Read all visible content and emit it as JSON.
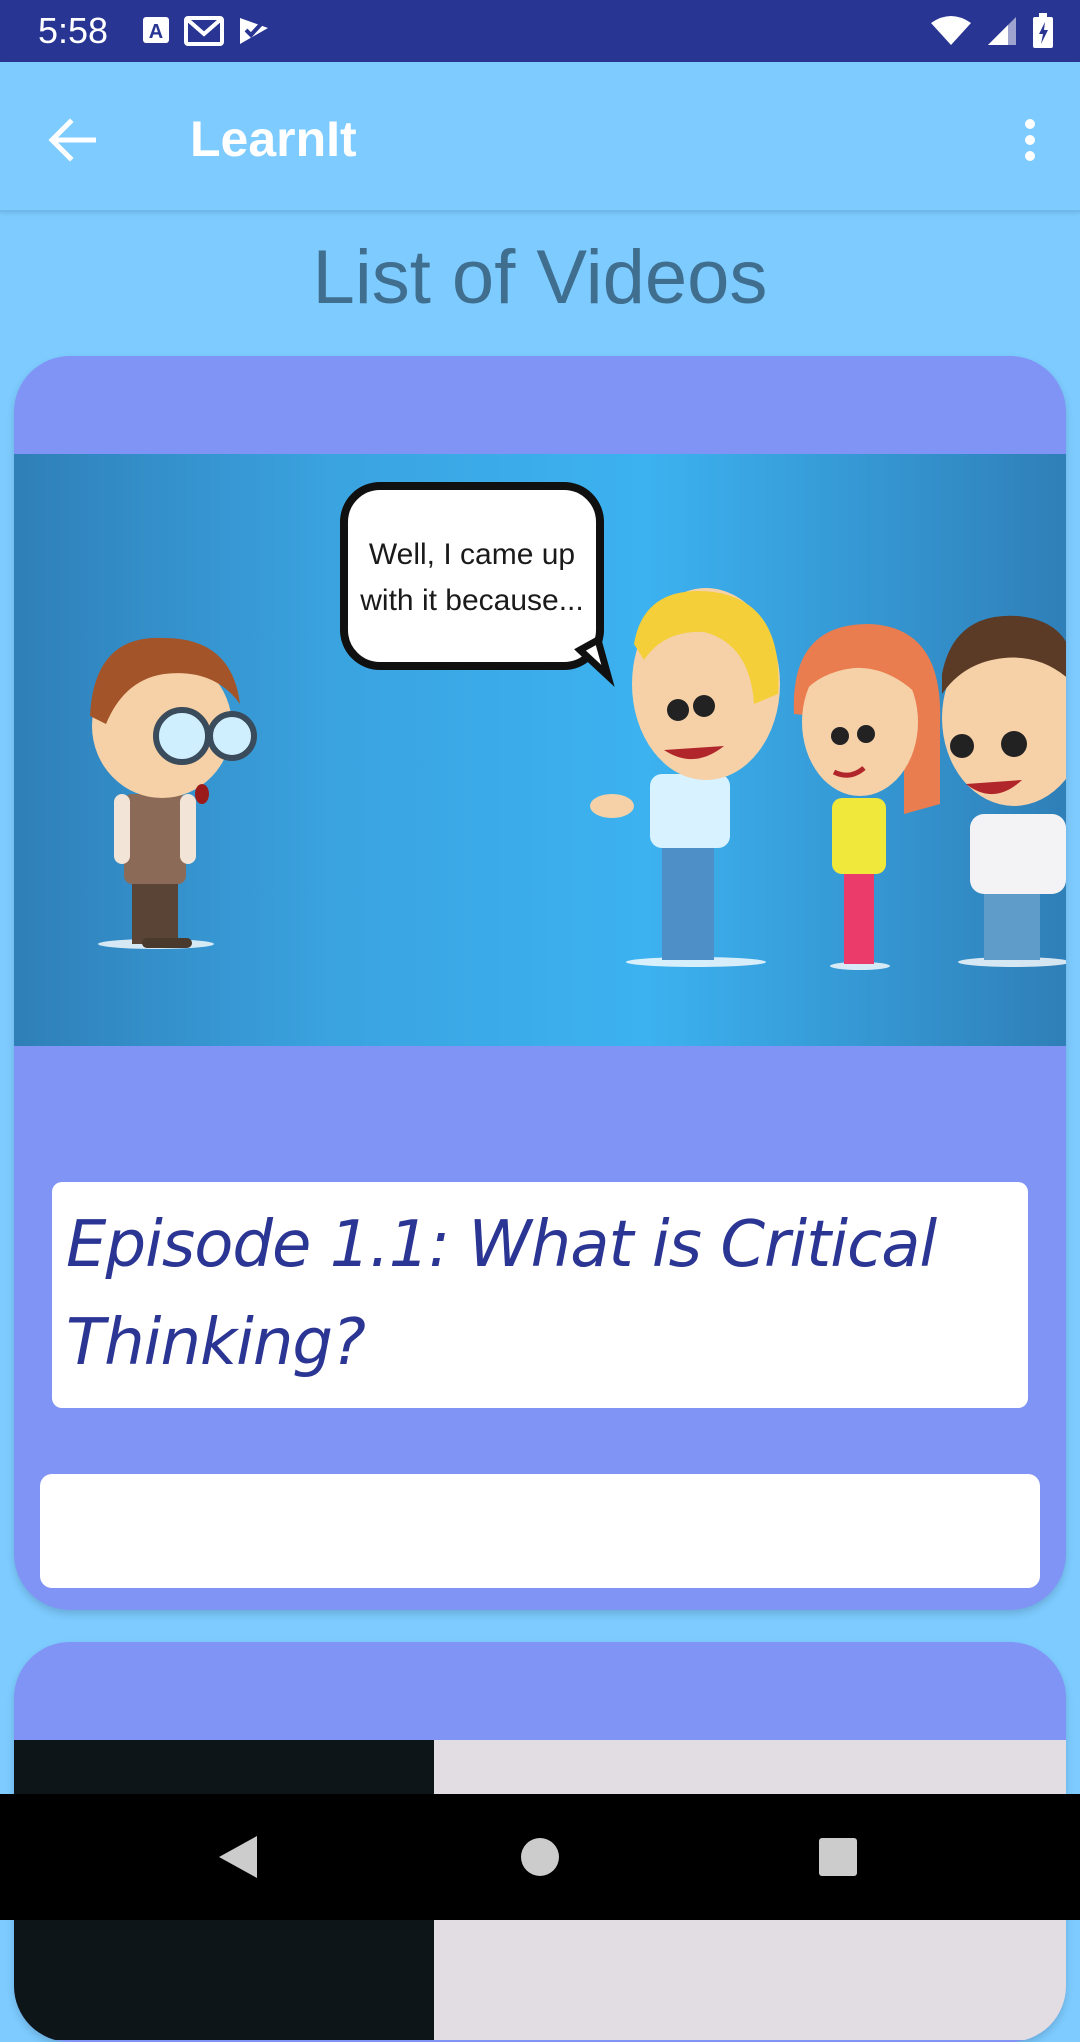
{
  "status_bar": {
    "time": "5:58",
    "left_icons": [
      "accessibility-a-icon",
      "gmail-icon",
      "checklist-icon"
    ],
    "right_icons": [
      "wifi-icon",
      "cell-signal-icon",
      "battery-icon"
    ]
  },
  "app_bar": {
    "title": "LearnIt",
    "back_icon": "arrow-back-icon",
    "menu_icon": "more-vert-icon"
  },
  "page": {
    "heading": "List of Videos"
  },
  "videos": [
    {
      "thumbnail_caption": "Well, I came up with it because...",
      "thumbnail_caption_line1": "Well, I came up",
      "thumbnail_caption_line2": "with it because...",
      "title": "Episode 1.1: What is Critical Thinking?",
      "description": ""
    },
    {
      "title": "",
      "description": ""
    }
  ],
  "colors": {
    "status_bar": "#283593",
    "app_bar": "#7dcbff",
    "card": "#8094f5",
    "heading": "#3f6e8f",
    "episode_title": "#2b3593"
  },
  "nav_bar": {
    "icons": [
      "nav-back-icon",
      "nav-home-icon",
      "nav-recents-icon"
    ]
  }
}
